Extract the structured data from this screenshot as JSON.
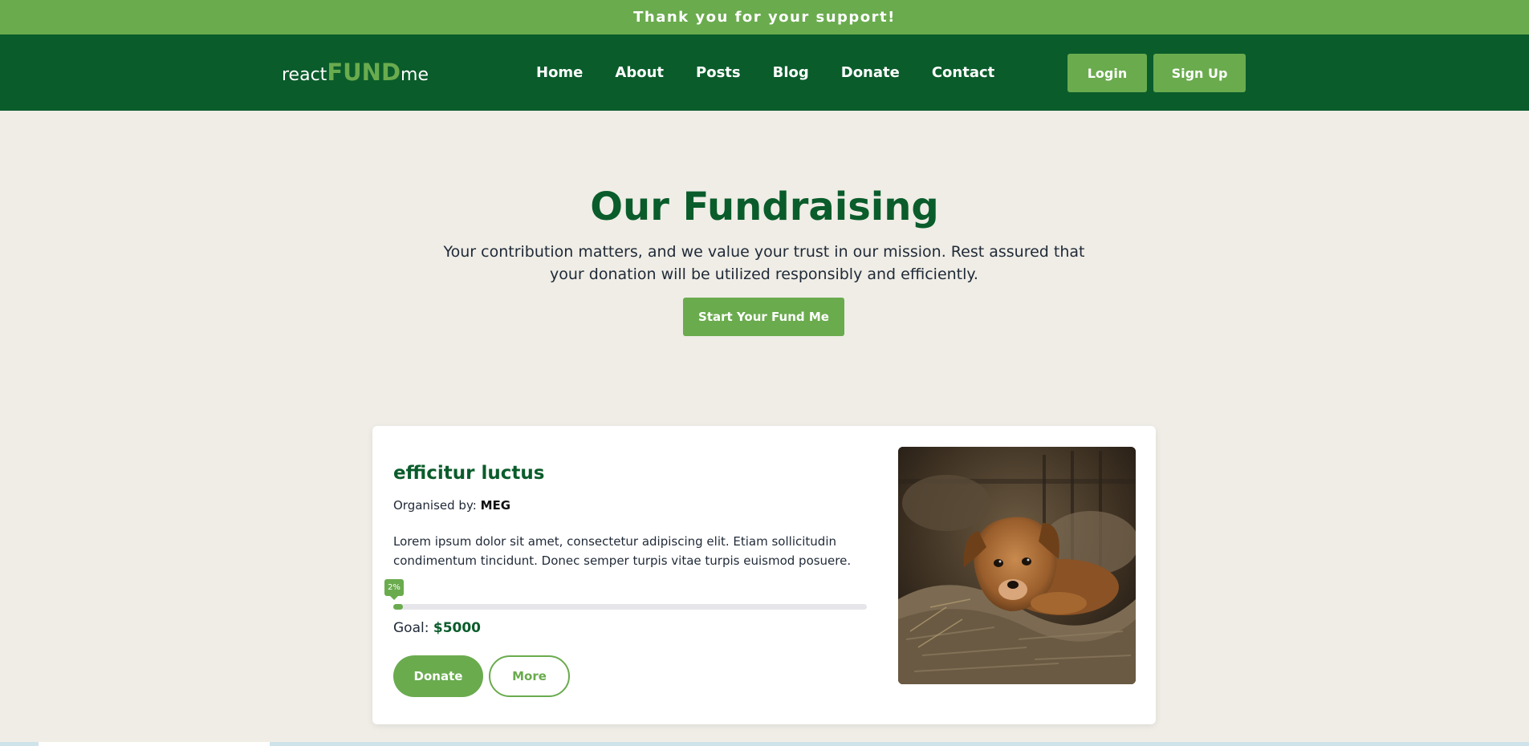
{
  "banner": {
    "text": "Thank you for your support!"
  },
  "brand": {
    "prefix": "react",
    "middle": "FUND",
    "suffix": "me"
  },
  "nav": {
    "items": [
      {
        "label": "Home"
      },
      {
        "label": "About"
      },
      {
        "label": "Posts"
      },
      {
        "label": "Blog"
      },
      {
        "label": "Donate"
      },
      {
        "label": "Contact"
      }
    ],
    "login_label": "Login",
    "signup_label": "Sign Up"
  },
  "hero": {
    "title": "Our Fundraising",
    "subtitle": "Your contribution matters, and we value your trust in our mission. Rest assured that your donation will be utilized responsibly and efficiently.",
    "cta_label": "Start Your Fund Me"
  },
  "campaign": {
    "title": "efficitur luctus",
    "organiser_label": "Organised by:",
    "organiser_name": "MEG",
    "description": "Lorem ipsum dolor sit amet, consectetur adipiscing elit. Etiam sollicitudin condimentum tincidunt. Donec semper turpis vitae turpis euismod posuere. ...",
    "progress_percent": 2,
    "progress_label": "2%",
    "goal_label": "Goal:",
    "goal_value": "$5000",
    "donate_label": "Donate",
    "more_label": "More",
    "image_subject": "puppy-photo"
  },
  "colors": {
    "banner": "#6aab4e",
    "nav": "#0a5c2b",
    "accent": "#6aab4e",
    "page_bg": "#efede6"
  }
}
